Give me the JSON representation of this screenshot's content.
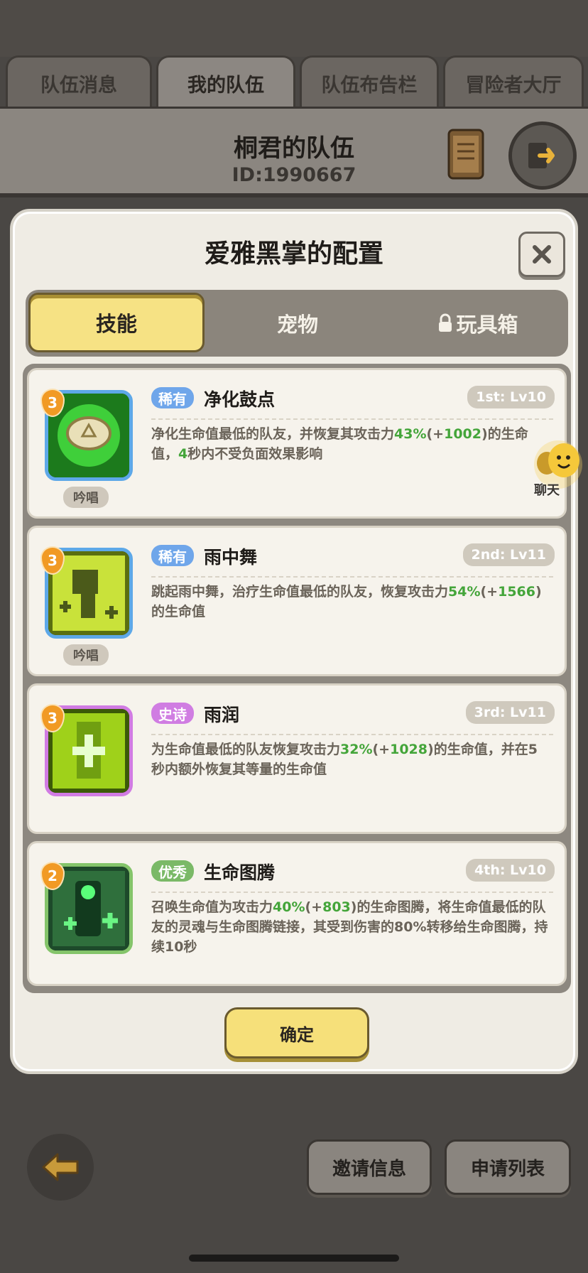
{
  "tabs": [
    {
      "label": "队伍消息"
    },
    {
      "label": "我的队伍"
    },
    {
      "label": "队伍布告栏"
    },
    {
      "label": "冒险者大厅"
    }
  ],
  "team": {
    "name": "桐君的队伍",
    "id": "ID:1990667"
  },
  "modal": {
    "title": "爱雅黑掌的配置",
    "segments": [
      {
        "label": "技能"
      },
      {
        "label": "宠物"
      },
      {
        "label": "玩具箱"
      }
    ],
    "skills": [
      {
        "level": "3",
        "rarity": "稀有",
        "name": "净化鼓点",
        "slot": "1st: Lv10",
        "chant": "吟唱",
        "desc_a": "净化生命值最低的队友，并恢复其攻击力",
        "pct": "43%",
        "p1": "(+",
        "bonus": "1002",
        "p2": ")",
        "desc_b": "的生命值，",
        "num": "4",
        "desc_c": "秒内不受负面效果影响"
      },
      {
        "level": "3",
        "rarity": "稀有",
        "name": "雨中舞",
        "slot": "2nd: Lv11",
        "chant": "吟唱",
        "desc_a": "跳起雨中舞，治疗生命值最低的队友，恢复攻击力",
        "pct": "54%",
        "p1": "(+",
        "bonus": "1566",
        "p2": ")",
        "desc_b": "的生命值"
      },
      {
        "level": "3",
        "rarity": "史诗",
        "name": "雨润",
        "slot": "3rd: Lv11",
        "desc_a": "为生命值最低的队友恢复攻击力",
        "pct": "32%",
        "p1": "(+",
        "bonus": "1028",
        "p2": ")",
        "desc_b": "的生命值，并在5秒内额外恢复其等量的生命值"
      },
      {
        "level": "2",
        "rarity": "优秀",
        "name": "生命图腾",
        "slot": "4th: Lv10",
        "desc_a": "召唤生命值为攻击力",
        "pct": "40%",
        "p1": "(+",
        "bonus": "803",
        "p2": ")",
        "desc_b": "的生命图腾，将生命值最低的队友的灵魂与生命图腾链接，其受到伤害的80%转移给生命图腾，持续10秒"
      }
    ],
    "confirm_label": "确定"
  },
  "chat_label": "聊天",
  "bottom": {
    "invite_label": "邀请信息",
    "apply_label": "申请列表"
  },
  "colors": {
    "highlight": "#44a53a",
    "rare": "#6fa6ea",
    "epic": "#d07de2",
    "good": "#7ab967",
    "confirm": "#f6e07a"
  }
}
